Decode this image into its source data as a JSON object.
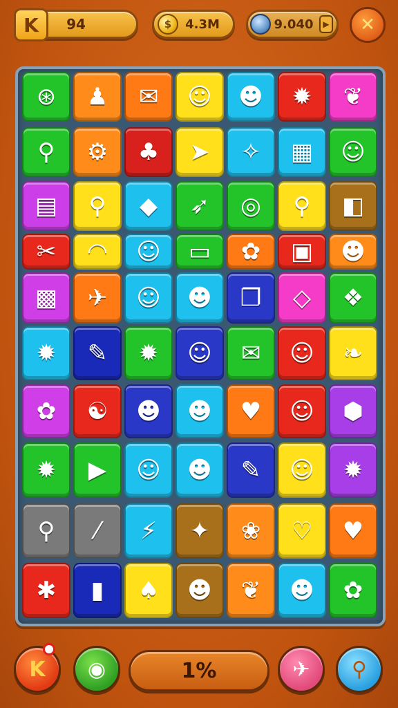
{
  "header": {
    "level_badge": "K",
    "level_value": "94",
    "coins_value": "4.3M",
    "gems_value": "9.040",
    "coin_glyph": "$",
    "close_glyph": "✕",
    "play_glyph": "▶"
  },
  "board": {
    "rows": [
      [
        {
          "color": "#23c42a",
          "glyph": "⊛",
          "icon": "planet-icon"
        },
        {
          "color": "#ff8c1a",
          "glyph": "♟",
          "icon": "pin-icon"
        },
        {
          "color": "#ff7a14",
          "glyph": "✉",
          "icon": "envelope-icon"
        },
        {
          "color": "#ffe01a",
          "glyph": "☺",
          "icon": "creature-icon"
        },
        {
          "color": "#1ec0ee",
          "glyph": "☻",
          "icon": "cat-face-icon"
        },
        {
          "color": "#e8281c",
          "glyph": "✹",
          "icon": "sun-icon"
        },
        {
          "color": "#f43cc8",
          "glyph": "❦",
          "icon": "blob-icon"
        }
      ],
      [
        {
          "color": "#23c42a",
          "glyph": "⚲",
          "icon": "magnifier-icon"
        },
        {
          "color": "#ff8c1a",
          "glyph": "⚙",
          "icon": "gear-face-icon"
        },
        {
          "color": "#d8201c",
          "glyph": "♣",
          "icon": "leaf-icon"
        },
        {
          "color": "#ffe01a",
          "glyph": "➤",
          "icon": "paper-plane-icon"
        },
        {
          "color": "#1ec0ee",
          "glyph": "✧",
          "icon": "flame-icon"
        },
        {
          "color": "#1ec0ee",
          "glyph": "▦",
          "icon": "tablet-icon"
        },
        {
          "color": "#23c42a",
          "glyph": "☺",
          "icon": "smiley-icon"
        }
      ],
      [
        {
          "color": "#cc3ee8",
          "glyph": "▤",
          "icon": "clipboard-icon"
        },
        {
          "color": "#ffe01a",
          "glyph": "⚲",
          "icon": "lollipop-icon"
        },
        {
          "color": "#1ec0ee",
          "glyph": "◆",
          "icon": "diamond-face-icon"
        },
        {
          "color": "#23c42a",
          "glyph": "➶",
          "icon": "arrow-icon"
        },
        {
          "color": "#23c42a",
          "glyph": "◎",
          "icon": "ring-icon"
        },
        {
          "color": "#ffe01a",
          "glyph": "⚲",
          "icon": "search-icon"
        },
        {
          "color": "#a8701a",
          "glyph": "◧",
          "icon": "cheese-icon"
        }
      ],
      [
        {
          "color": "#e8281c",
          "glyph": "✂",
          "icon": "scissors-icon"
        },
        {
          "color": "#ffe01a",
          "glyph": "◠",
          "icon": "rainbow-icon"
        },
        {
          "color": "#1ec0ee",
          "glyph": "☺",
          "icon": "duck-icon"
        },
        {
          "color": "#23c42a",
          "glyph": "▭",
          "icon": "box-icon"
        },
        {
          "color": "#ff7a14",
          "glyph": "✿",
          "icon": "bow-icon"
        },
        {
          "color": "#e8281c",
          "glyph": "▣",
          "icon": "radio-icon"
        },
        {
          "color": "#ff8c1a",
          "glyph": "☻",
          "icon": "bird-icon"
        }
      ],
      [
        {
          "color": "#d03ee8",
          "glyph": "▩",
          "icon": "safe-icon"
        },
        {
          "color": "#ff7a14",
          "glyph": "✈",
          "icon": "rocket-icon"
        },
        {
          "color": "#1ec0ee",
          "glyph": "☺",
          "icon": "bubble-face-icon"
        },
        {
          "color": "#1ec0ee",
          "glyph": "☻",
          "icon": "hat-face-icon"
        },
        {
          "color": "#2a38c8",
          "glyph": "❐",
          "icon": "book-icon"
        },
        {
          "color": "#f43cc8",
          "glyph": "◇",
          "icon": "cube-icon"
        },
        {
          "color": "#23c42a",
          "glyph": "❖",
          "icon": "recycle-icon"
        }
      ],
      [
        {
          "color": "#1ec0ee",
          "glyph": "✹",
          "icon": "sunflower-icon"
        },
        {
          "color": "#1a2ab8",
          "glyph": "✎",
          "icon": "pen-icon"
        },
        {
          "color": "#23c42a",
          "glyph": "✹",
          "icon": "sun-face-icon"
        },
        {
          "color": "#2a38c8",
          "glyph": "☺",
          "icon": "bell-face-icon"
        },
        {
          "color": "#23c42a",
          "glyph": "✉",
          "icon": "mail-bag-icon"
        },
        {
          "color": "#e8281c",
          "glyph": "☺",
          "icon": "pig-icon"
        },
        {
          "color": "#ffe01a",
          "glyph": "❧",
          "icon": "feather-icon"
        }
      ],
      [
        {
          "color": "#d03ee8",
          "glyph": "✿",
          "icon": "flower-face-icon"
        },
        {
          "color": "#e8281c",
          "glyph": "☯",
          "icon": "clock-face-icon"
        },
        {
          "color": "#2a38c8",
          "glyph": "☻",
          "icon": "devil-face-icon"
        },
        {
          "color": "#1ec0ee",
          "glyph": "☻",
          "icon": "acorn-icon"
        },
        {
          "color": "#ff7a14",
          "glyph": "♥",
          "icon": "heart-face-icon"
        },
        {
          "color": "#e8281c",
          "glyph": "☺",
          "icon": "chat-face-icon"
        },
        {
          "color": "#a83ee8",
          "glyph": "⬢",
          "icon": "hexagon-face-icon"
        }
      ],
      [
        {
          "color": "#23c42a",
          "glyph": "✹",
          "icon": "sun-bow-icon"
        },
        {
          "color": "#23c42a",
          "glyph": "▶",
          "icon": "triangle-icon"
        },
        {
          "color": "#1ec0ee",
          "glyph": "☺",
          "icon": "chick-icon"
        },
        {
          "color": "#1ec0ee",
          "glyph": "☻",
          "icon": "girl-face-icon"
        },
        {
          "color": "#2a38c8",
          "glyph": "✎",
          "icon": "brush-icon"
        },
        {
          "color": "#ffe01a",
          "glyph": "☺",
          "icon": "speech-face-icon"
        },
        {
          "color": "#a83ee8",
          "glyph": "✹",
          "icon": "sun-smile-icon"
        }
      ],
      [
        {
          "color": "#7a7a7a",
          "glyph": "⚲",
          "icon": "key-icon"
        },
        {
          "color": "#7a7a7a",
          "glyph": "⁄",
          "icon": "crayon-icon"
        },
        {
          "color": "#1ec0ee",
          "glyph": "⚡",
          "icon": "lightning-icon"
        },
        {
          "color": "#a8701a",
          "glyph": "✦",
          "icon": "bowtie-icon"
        },
        {
          "color": "#ff8c1a",
          "glyph": "❀",
          "icon": "radish-icon"
        },
        {
          "color": "#ffe01a",
          "glyph": "♡",
          "icon": "heart-pin-icon"
        },
        {
          "color": "#ff7a14",
          "glyph": "♥",
          "icon": "heart-icon"
        }
      ],
      [
        {
          "color": "#e8281c",
          "glyph": "✱",
          "icon": "molecule-icon"
        },
        {
          "color": "#1a2ab8",
          "glyph": "▮",
          "icon": "bottle-icon"
        },
        {
          "color": "#ffe01a",
          "glyph": "♠",
          "icon": "drop-icon"
        },
        {
          "color": "#a8701a",
          "glyph": "☻",
          "icon": "bird-face-icon"
        },
        {
          "color": "#ff8c1a",
          "glyph": "❦",
          "icon": "leaf-green-icon"
        },
        {
          "color": "#1ec0ee",
          "glyph": "☻",
          "icon": "rock-face-icon"
        },
        {
          "color": "#23c42a",
          "glyph": "✿",
          "icon": "cog-flower-icon"
        }
      ]
    ]
  },
  "footer": {
    "left_button_glyph": "K",
    "map_button_glyph": "◉",
    "progress_value": "1%",
    "send_button_glyph": "✈",
    "tool_button_glyph": "⚲"
  }
}
